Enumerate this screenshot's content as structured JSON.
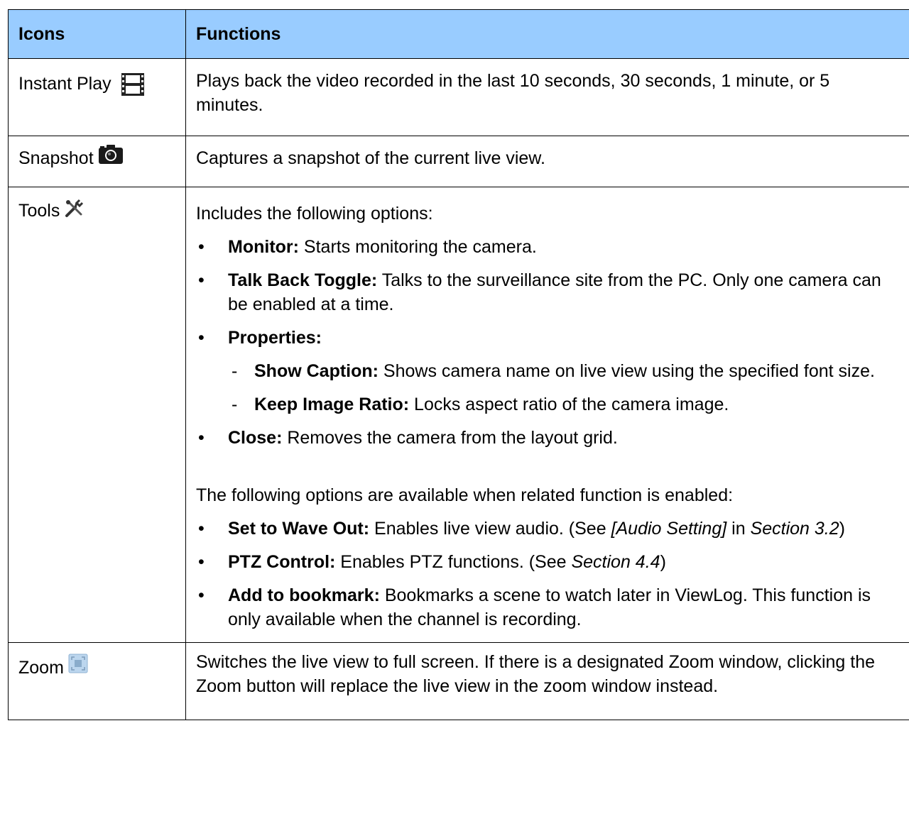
{
  "header": {
    "col1": "Icons",
    "col2": "Functions"
  },
  "rows": {
    "instant_play": {
      "label": "Instant Play",
      "icon": "film-strip-icon",
      "description": "Plays back the video recorded in the last 10 seconds, 30 seconds, 1 minute, or 5 minutes."
    },
    "snapshot": {
      "label": "Snapshot",
      "icon": "camera-icon",
      "description": "Captures a snapshot of the current live view."
    },
    "tools": {
      "label": "Tools",
      "icon": "tools-icon",
      "intro": "Includes the following options:",
      "monitor": {
        "term": "Monitor:",
        "text": " Starts monitoring the camera."
      },
      "talk_back": {
        "term": "Talk Back Toggle:",
        "text": " Talks to the surveillance site from the PC. Only one camera can be enabled at a time."
      },
      "properties": {
        "term": "Properties:"
      },
      "show_caption": {
        "term": "Show Caption:",
        "text": " Shows camera name on live view using the specified font size."
      },
      "keep_ratio": {
        "term": "Keep Image Ratio:",
        "text": " Locks aspect ratio of the camera image."
      },
      "close": {
        "term": "Close:",
        "text": " Removes the camera from the layout grid."
      },
      "intro2": "The following options are available when related function is enabled:",
      "wave_out": {
        "term": "Set to Wave Out:",
        "text1": " Enables live view audio. (See ",
        "ref1": "[Audio Setting]",
        "text2": " in ",
        "ref2": "Section 3.2",
        "text3": ")"
      },
      "ptz": {
        "term": "PTZ Control:",
        "text1": " Enables PTZ functions. (See ",
        "ref1": "Section 4.4",
        "text2": ")"
      },
      "bookmark": {
        "term": "Add to bookmark:",
        "text": " Bookmarks a scene to watch later in ViewLog. This function is only available when the channel is recording."
      }
    },
    "zoom": {
      "label": "Zoom",
      "icon": "zoom-fullscreen-icon",
      "description": "Switches the live view to full screen. If there is a designated Zoom window, clicking the Zoom button will replace the live view in the zoom window instead."
    }
  },
  "colors": {
    "header_bg": "#99ccff",
    "border": "#000000"
  }
}
